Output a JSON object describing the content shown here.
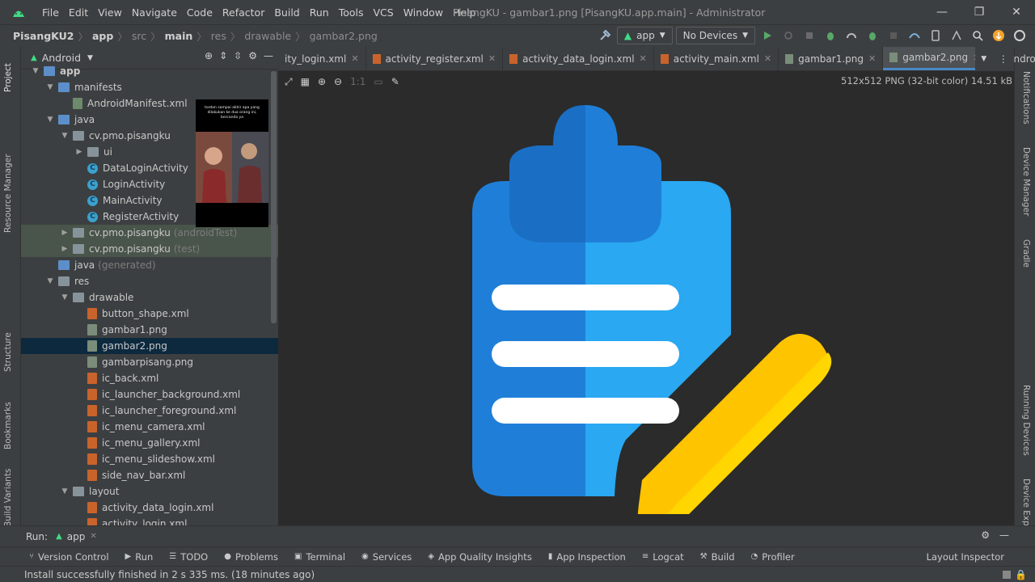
{
  "title_bar": {
    "menu": [
      "File",
      "Edit",
      "View",
      "Navigate",
      "Code",
      "Refactor",
      "Build",
      "Run",
      "Tools",
      "VCS",
      "Window",
      "Help"
    ],
    "title": "PisangKU - gambar1.png [PisangKU.app.main] - Administrator",
    "window_controls": [
      "minimize-icon",
      "restore-icon",
      "close-icon"
    ]
  },
  "navbar": {
    "breadcrumb": [
      "PisangKU2",
      "app",
      "src",
      "main",
      "res",
      "drawable",
      "gambar2.png"
    ],
    "run_config": "app",
    "device": "No Devices"
  },
  "left_strip": [
    "Project",
    "Resource Manager",
    "Structure",
    "Bookmarks",
    "Build Variants"
  ],
  "right_strip": [
    "Notifications",
    "Device Manager",
    "Gradle",
    "Running Devices",
    "Device Explorer"
  ],
  "project_panel": {
    "view": "Android",
    "tree": [
      {
        "label": "app",
        "depth": 0,
        "arrow": "open",
        "icon": "folder-blue"
      },
      {
        "label": "manifests",
        "depth": 1,
        "arrow": "open",
        "icon": "folder-blue"
      },
      {
        "label": "AndroidManifest.xml",
        "depth": 2,
        "arrow": "",
        "icon": "manifest"
      },
      {
        "label": "java",
        "depth": 1,
        "arrow": "open",
        "icon": "folder-blue"
      },
      {
        "label": "cv.pmo.pisangku",
        "depth": 2,
        "arrow": "open",
        "icon": "pkg"
      },
      {
        "label": "ui",
        "depth": 3,
        "arrow": "closed",
        "icon": "pkg"
      },
      {
        "label": "DataLoginActivity",
        "depth": 3,
        "arrow": "",
        "icon": "class"
      },
      {
        "label": "LoginActivity",
        "depth": 3,
        "arrow": "",
        "icon": "class"
      },
      {
        "label": "MainActivity",
        "depth": 3,
        "arrow": "",
        "icon": "class"
      },
      {
        "label": "RegisterActivity",
        "depth": 3,
        "arrow": "",
        "icon": "class"
      },
      {
        "label": "cv.pmo.pisangku",
        "suffix": "(androidTest)",
        "depth": 2,
        "arrow": "closed",
        "icon": "pkg",
        "state": "test"
      },
      {
        "label": "cv.pmo.pisangku",
        "suffix": "(test)",
        "depth": 2,
        "arrow": "closed",
        "icon": "pkg",
        "state": "test"
      },
      {
        "label": "java",
        "suffix": "(generated)",
        "depth": 1,
        "arrow": "",
        "icon": "folder-blue"
      },
      {
        "label": "res",
        "depth": 1,
        "arrow": "open",
        "icon": "folder"
      },
      {
        "label": "drawable",
        "depth": 2,
        "arrow": "open",
        "icon": "folder"
      },
      {
        "label": "button_shape.xml",
        "depth": 3,
        "arrow": "",
        "icon": "xml"
      },
      {
        "label": "gambar1.png",
        "depth": 3,
        "arrow": "",
        "icon": "png"
      },
      {
        "label": "gambar2.png",
        "depth": 3,
        "arrow": "",
        "icon": "png",
        "state": "selected"
      },
      {
        "label": "gambarpisang.png",
        "depth": 3,
        "arrow": "",
        "icon": "png"
      },
      {
        "label": "ic_back.xml",
        "depth": 3,
        "arrow": "",
        "icon": "xml"
      },
      {
        "label": "ic_launcher_background.xml",
        "depth": 3,
        "arrow": "",
        "icon": "xml"
      },
      {
        "label": "ic_launcher_foreground.xml",
        "depth": 3,
        "arrow": "",
        "icon": "xml"
      },
      {
        "label": "ic_menu_camera.xml",
        "depth": 3,
        "arrow": "",
        "icon": "xml"
      },
      {
        "label": "ic_menu_gallery.xml",
        "depth": 3,
        "arrow": "",
        "icon": "xml"
      },
      {
        "label": "ic_menu_slideshow.xml",
        "depth": 3,
        "arrow": "",
        "icon": "xml"
      },
      {
        "label": "side_nav_bar.xml",
        "depth": 3,
        "arrow": "",
        "icon": "xml"
      },
      {
        "label": "layout",
        "depth": 2,
        "arrow": "open",
        "icon": "folder"
      },
      {
        "label": "activity_data_login.xml",
        "depth": 3,
        "arrow": "",
        "icon": "xml"
      },
      {
        "label": "activity_login.xml",
        "depth": 3,
        "arrow": "",
        "icon": "xml"
      }
    ]
  },
  "thumbnail": {
    "caption": "tonton sampai akhir apa yang dilakukan ke dua orang ini, bercanda ya"
  },
  "editor_tabs": [
    {
      "label": "ity_login.xml",
      "type": "xml"
    },
    {
      "label": "activity_register.xml",
      "type": "xml"
    },
    {
      "label": "activity_data_login.xml",
      "type": "xml"
    },
    {
      "label": "activity_main.xml",
      "type": "xml"
    },
    {
      "label": "gambar1.png",
      "type": "png"
    },
    {
      "label": "gambar2.png",
      "type": "png",
      "active": true
    },
    {
      "label": "Andro",
      "type": "android"
    }
  ],
  "image_editor": {
    "info": "512x512 PNG (32-bit color) 14.51 kB",
    "tools": [
      "fit-zoom-icon",
      "grid-icon",
      "zoom-in-icon",
      "zoom-out-icon",
      "actual-size-icon",
      "background-icon",
      "color-picker-icon"
    ]
  },
  "run_bar": {
    "label": "Run:",
    "tab": "app"
  },
  "bottom_tools": [
    {
      "label": "Version Control",
      "icon": "vcs-icon"
    },
    {
      "label": "Run",
      "icon": "run-icon"
    },
    {
      "label": "TODO",
      "icon": "todo-icon"
    },
    {
      "label": "Problems",
      "icon": "problems-icon"
    },
    {
      "label": "Terminal",
      "icon": "terminal-icon"
    },
    {
      "label": "Services",
      "icon": "services-icon"
    },
    {
      "label": "App Quality Insights",
      "icon": "insights-icon"
    },
    {
      "label": "App Inspection",
      "icon": "inspection-icon"
    },
    {
      "label": "Logcat",
      "icon": "logcat-icon"
    },
    {
      "label": "Build",
      "icon": "build-icon"
    },
    {
      "label": "Profiler",
      "icon": "profiler-icon"
    }
  ],
  "layout_inspector": "Layout Inspector",
  "status": "Install successfully finished in 2 s 335 ms. (18 minutes ago)",
  "colors": {
    "clipboard_dark": "#1f7fd8",
    "clipboard_light": "#2aa8f2",
    "pencil_dark": "#ffc400",
    "pencil_light": "#ffd600",
    "selection": "#0d293e",
    "accent": "#4a88c7"
  }
}
